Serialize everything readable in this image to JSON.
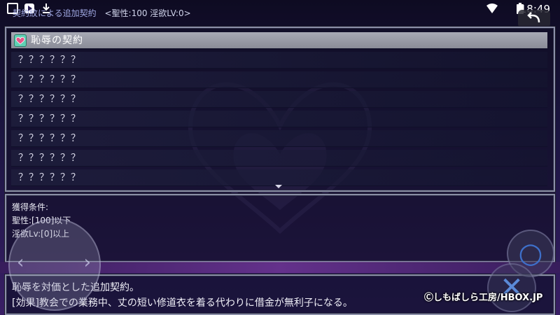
{
  "status_bar": {
    "time": "18:49",
    "icons": [
      "gallery-icon",
      "play-store-icon",
      "download-icon",
      "wifi-icon",
      "battery-icon"
    ]
  },
  "header": {
    "title": "契約紋による追加契約",
    "stats": "<聖性:100 淫欲LV:0>"
  },
  "contract_list": {
    "selected": {
      "label": "恥辱の契約",
      "icon": "heart-icon"
    },
    "locked_items": [
      "？？？？？？",
      "？？？？？？",
      "？？？？？？",
      "？？？？？？",
      "？？？？？？",
      "？？？？？？",
      "？？？？？？"
    ]
  },
  "conditions": {
    "heading": "獲得条件:",
    "lines": [
      "聖性:[100]以下",
      "淫欲Lv:[0]以上"
    ]
  },
  "description": {
    "line1": "恥辱を対価とした追加契約。",
    "line2": "[効果]教会での業務中、丈の短い修道衣を着る代わりに借金が無利子になる。"
  },
  "overlay": {
    "back_icon": "back-arrow-icon",
    "circle_button": "○",
    "cross_button": "✕",
    "copyright": "Ⓒしもばしら工房/HBOX.JP"
  },
  "colors": {
    "accent_heart": "#e8558a",
    "selected_row": "#9b9daa"
  }
}
